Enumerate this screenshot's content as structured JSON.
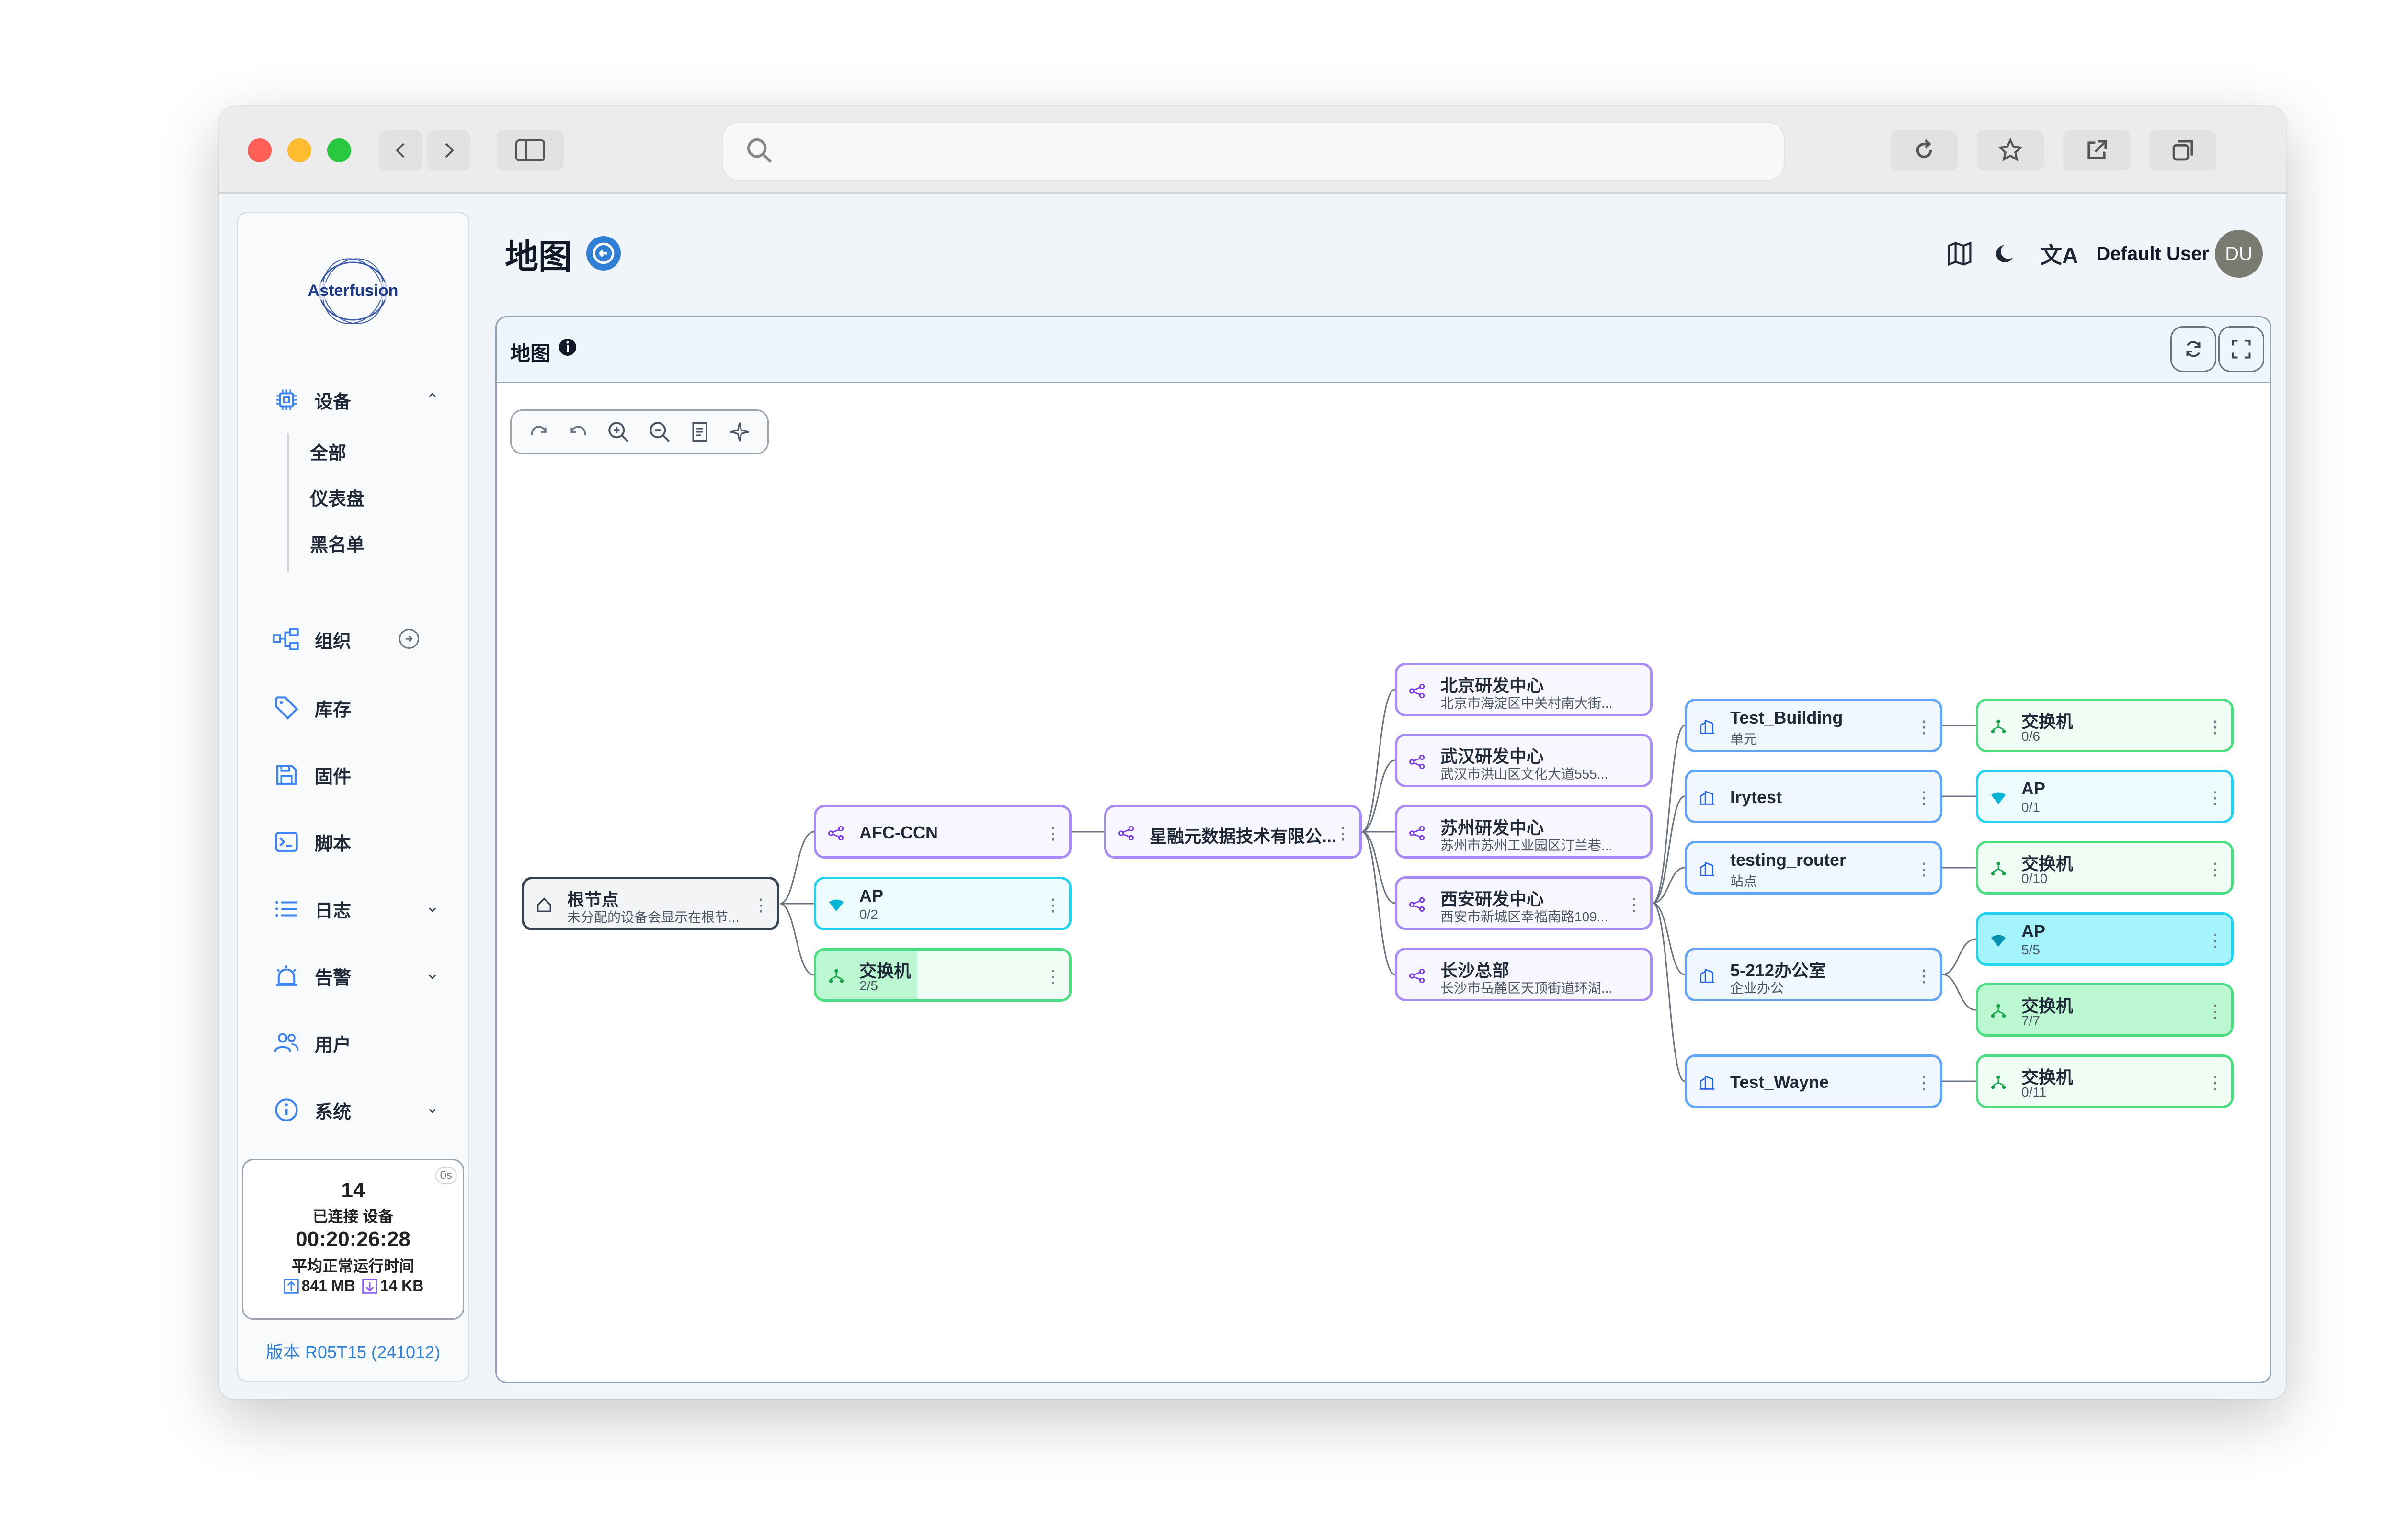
{
  "app": {
    "page_title": "地图",
    "user_name": "Default User",
    "user_initials": "DU",
    "logo_text": "Asterfusion",
    "version": "版本 R05T15 (241012)"
  },
  "sidebar": {
    "devices": "设备",
    "sub_items": [
      "全部",
      "仪表盘",
      "黑名单"
    ],
    "org": "组织",
    "inventory": "库存",
    "firmware": "固件",
    "script": "脚本",
    "logs": "日志",
    "alarm": "告警",
    "users": "用户",
    "system": "系统"
  },
  "stats": {
    "badge": "0s",
    "connected_count": "14",
    "connected_label": "已连接 设备",
    "uptime": "00:20:26:28",
    "uptime_label": "平均正常运行时间",
    "tx": "841 MB",
    "rx": "14 KB"
  },
  "card": {
    "title": "地图"
  },
  "nodes": {
    "root": {
      "title": "根节点",
      "sub": "未分配的设备会显示在根节..."
    },
    "afc": {
      "title": "AFC-CCN"
    },
    "ap1": {
      "title": "AP",
      "sub": "0/2"
    },
    "sw1": {
      "title": "交换机",
      "sub": "2/5"
    },
    "company": {
      "title": "星融元数据技术有限公..."
    },
    "bj": {
      "title": "北京研发中心",
      "sub": "北京市海淀区中关村南大街..."
    },
    "wh": {
      "title": "武汉研发中心",
      "sub": "武汉市洪山区文化大道555..."
    },
    "sz": {
      "title": "苏州研发中心",
      "sub": "苏州市苏州工业园区汀兰巷..."
    },
    "xa": {
      "title": "西安研发中心",
      "sub": "西安市新城区幸福南路109..."
    },
    "cs": {
      "title": "长沙总部",
      "sub": "长沙市岳麓区天顶街道环湖..."
    },
    "tb": {
      "title": "Test_Building",
      "sub": "单元"
    },
    "iry": {
      "title": "Irytest"
    },
    "tr": {
      "title": "testing_router",
      "sub": "站点"
    },
    "o5": {
      "title": "5-212办公室",
      "sub": "企业办公"
    },
    "tw": {
      "title": "Test_Wayne"
    },
    "r1": {
      "title": "交换机",
      "sub": "0/6"
    },
    "r2": {
      "title": "AP",
      "sub": "0/1"
    },
    "r3": {
      "title": "交换机",
      "sub": "0/10"
    },
    "r4": {
      "title": "AP",
      "sub": "5/5"
    },
    "r5": {
      "title": "交换机",
      "sub": "7/7"
    },
    "r6": {
      "title": "交换机",
      "sub": "0/11"
    }
  },
  "colors": {
    "purple": "#a78bfa",
    "blue": "#60a5fa",
    "cyan": "#22d3ee",
    "green": "#4ade80",
    "accent": "#2f7fd6"
  }
}
